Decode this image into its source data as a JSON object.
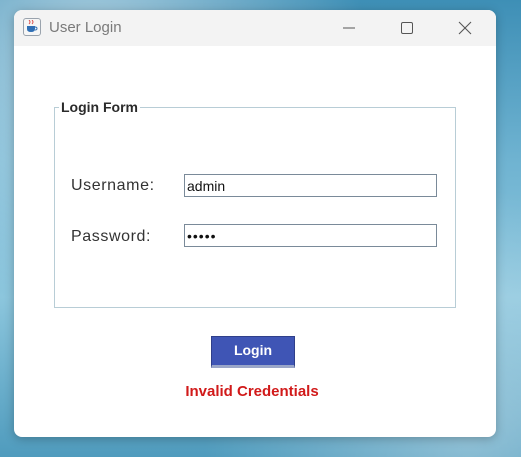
{
  "window": {
    "title": "User Login",
    "icon": "java-coffee-cup-icon",
    "controls": [
      "minimize-icon",
      "maximize-icon",
      "close-icon"
    ]
  },
  "form": {
    "legend": "Login Form",
    "username_label": "Username:",
    "username_value": "admin",
    "password_label": "Password:",
    "password_value": "•••••",
    "login_label": "Login"
  },
  "status": {
    "message": "Invalid Credentials",
    "color": "#d11a1a"
  },
  "colors": {
    "button_bg": "#3f55b5",
    "border": "#b8cdd6"
  }
}
